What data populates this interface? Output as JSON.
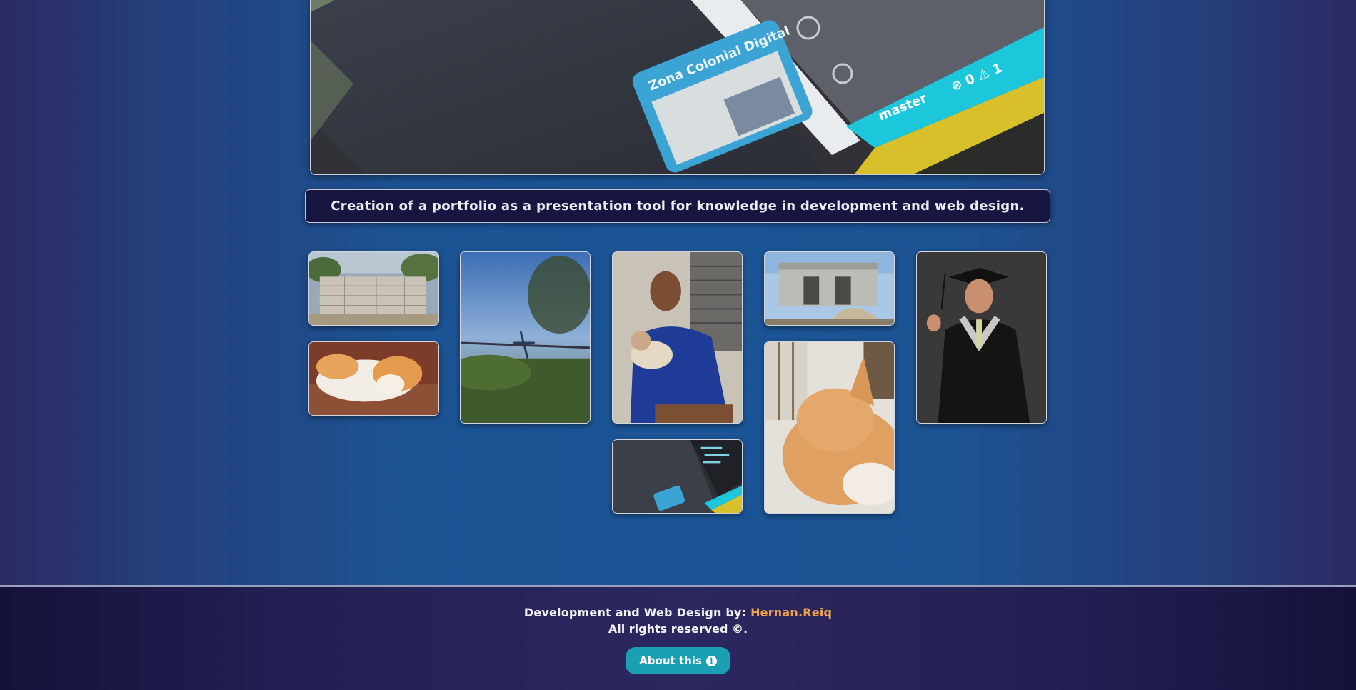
{
  "hero": {
    "alt": "Laptop screen with code editor",
    "editor_branch": "master",
    "editor_counts": "⊗ 0 ⚠ 1",
    "card_title": "Zona Colonial Digital"
  },
  "description": "Creation of a portfolio as a presentation tool for knowledge in development and web design.",
  "gallery": [
    {
      "alt": "Construction block walls"
    },
    {
      "alt": "Sleeping orange and white kitten"
    },
    {
      "alt": "Barbed wire and palm tree"
    },
    {
      "alt": "Mother holding a baby"
    },
    {
      "alt": "Laptop screen with code editor"
    },
    {
      "alt": "House under construction"
    },
    {
      "alt": "Orange cat close-up"
    },
    {
      "alt": "Graduate in gown and cap"
    }
  ],
  "footer": {
    "credit_prefix": "Development and Web Design by:",
    "author": "Hernan.Reiq",
    "rights": "All rights reserved ©.",
    "about_label": "About this",
    "about_icon": "info-icon"
  },
  "colors": {
    "accent": "#f2a24a",
    "button": "#1b9fb3",
    "panel": "#171640"
  }
}
